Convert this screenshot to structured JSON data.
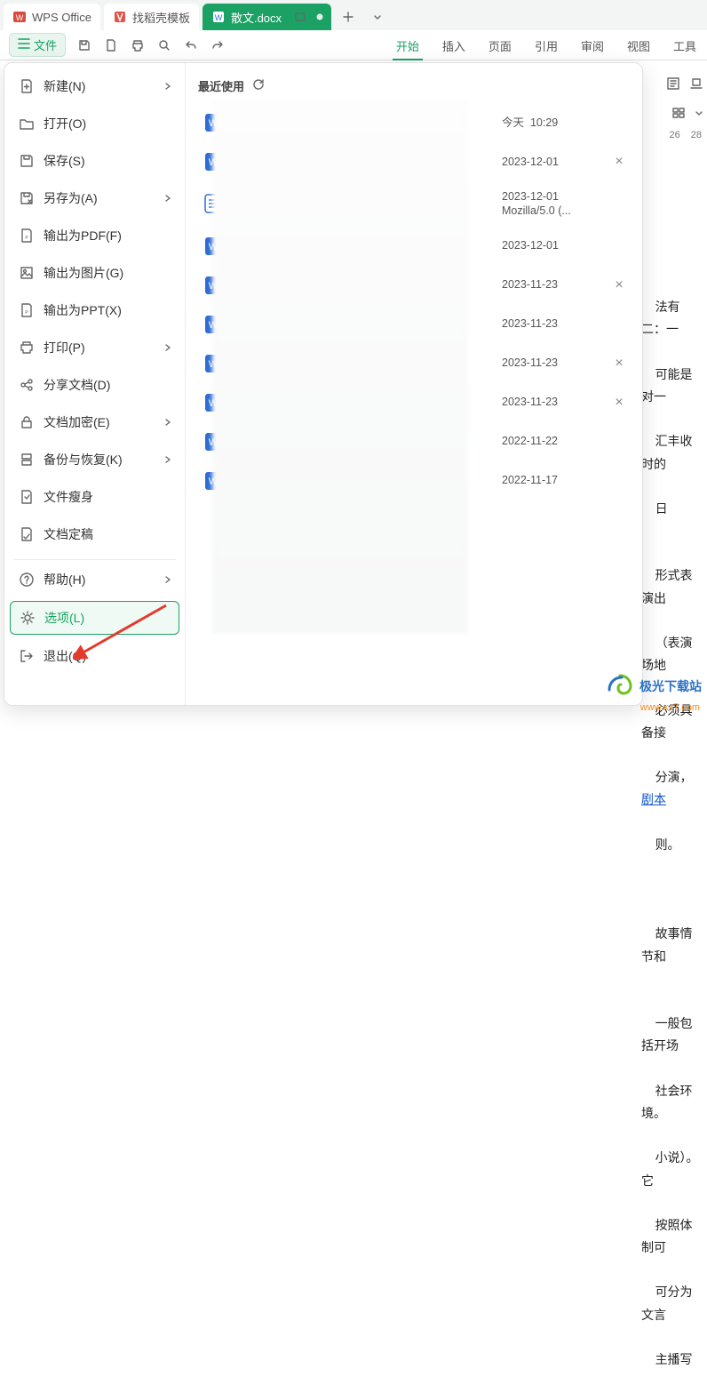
{
  "tabs": {
    "home": "WPS Office",
    "template": "找稻壳模板",
    "doc": "散文.docx"
  },
  "file_button": "文件",
  "ribbon": {
    "items": [
      "开始",
      "插入",
      "页面",
      "引用",
      "审阅",
      "视图",
      "工具"
    ],
    "active": 0
  },
  "file_menu": [
    {
      "label": "新建(N)",
      "chevron": true,
      "icon": "new"
    },
    {
      "label": "打开(O)",
      "chevron": false,
      "icon": "open"
    },
    {
      "label": "保存(S)",
      "chevron": false,
      "icon": "save"
    },
    {
      "label": "另存为(A)",
      "chevron": true,
      "icon": "saveas"
    },
    {
      "label": "输出为PDF(F)",
      "chevron": false,
      "icon": "pdf"
    },
    {
      "label": "输出为图片(G)",
      "chevron": false,
      "icon": "img"
    },
    {
      "label": "输出为PPT(X)",
      "chevron": false,
      "icon": "ppt"
    },
    {
      "label": "打印(P)",
      "chevron": true,
      "icon": "print"
    },
    {
      "label": "分享文档(D)",
      "chevron": false,
      "icon": "share"
    },
    {
      "label": "文档加密(E)",
      "chevron": true,
      "icon": "lock"
    },
    {
      "label": "备份与恢复(K)",
      "chevron": true,
      "icon": "backup"
    },
    {
      "label": "文件瘦身",
      "chevron": false,
      "icon": "slim"
    },
    {
      "label": "文档定稿",
      "chevron": false,
      "icon": "final"
    },
    {
      "label": "帮助(H)",
      "chevron": true,
      "icon": "help",
      "sep_before": true
    },
    {
      "label": "选项(L)",
      "chevron": false,
      "icon": "options",
      "selected": true
    },
    {
      "label": "退出(Q)",
      "chevron": false,
      "icon": "exit"
    }
  ],
  "recent": {
    "heading": "最近使用",
    "items": [
      {
        "meta1": "今天",
        "meta2": "10:29",
        "close": false,
        "icon": "doc"
      },
      {
        "meta1": "2023-12-01",
        "meta2": "",
        "close": true,
        "icon": "doc"
      },
      {
        "meta1": "2023-12-01",
        "meta2": "Mozilla/5.0 (...",
        "close": false,
        "icon": "txt"
      },
      {
        "meta1": "2023-12-01",
        "meta2": "",
        "close": false,
        "icon": "doc"
      },
      {
        "meta1": "2023-11-23",
        "meta2": "",
        "close": true,
        "icon": "doc"
      },
      {
        "meta1": "2023-11-23",
        "meta2": "",
        "close": false,
        "icon": "doc"
      },
      {
        "meta1": "2023-11-23",
        "meta2": "",
        "close": true,
        "icon": "doc"
      },
      {
        "meta1": "2023-11-23",
        "meta2": "",
        "close": true,
        "icon": "doc"
      },
      {
        "meta1": "2022-11-22",
        "meta2": "",
        "close": false,
        "icon": "doc"
      },
      {
        "meta1": "2022-11-17",
        "meta2": "",
        "close": false,
        "icon": "doc"
      }
    ]
  },
  "ruler": [
    "26",
    "28"
  ],
  "bg_text_lines": [
    "法有二：一",
    "可能是对一",
    "汇丰收时的",
    "日",
    "形式表演出",
    "（表演场地",
    "必须具备接",
    "分演，",
    "则。",
    "",
    "故事情节和",
    "",
    "一般包括开场",
    "社会环境。",
    "小说）。它",
    "按照体制可",
    "可分为文言",
    "主播写"
  ],
  "bg_link": "剧本",
  "watermark": {
    "title": "极光下载站",
    "url": "www.xz7.com"
  }
}
